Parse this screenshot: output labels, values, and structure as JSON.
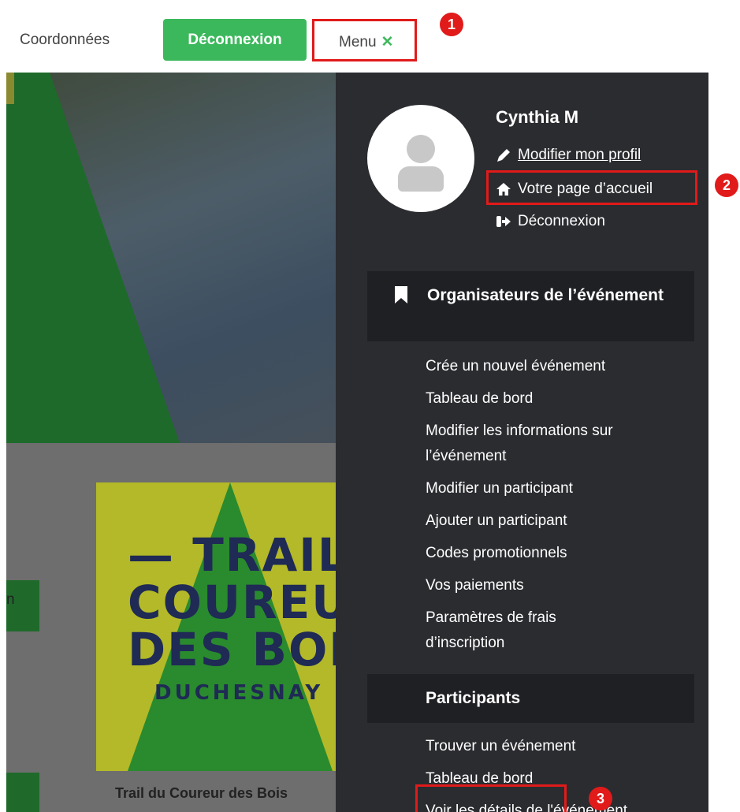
{
  "header": {
    "nav_link": "Coordonnées",
    "logout_button": "Déconnexion",
    "menu_toggle": "Menu",
    "close_glyph": "✕"
  },
  "annotations": [
    "1",
    "2",
    "3"
  ],
  "background": {
    "poster_lines": [
      "— TRAIL",
      "COUREUR",
      "DES BOIS",
      "DUCHESNAY"
    ],
    "card_title": "Trail du Coureur des Bois",
    "fragment": "n"
  },
  "side_menu": {
    "user_name": "Cynthia M",
    "profile_links": [
      {
        "label": "Modifier mon profil",
        "icon": "pencil-icon"
      },
      {
        "label": "Votre page d’accueil",
        "icon": "home-icon"
      },
      {
        "label": "Déconnexion",
        "icon": "sign-out-icon"
      }
    ],
    "organizers": {
      "title": "Organisateurs de l’événement",
      "icon": "bookmark-icon",
      "items": [
        "Crée un nouvel événement",
        "Tableau de bord",
        "Modifier les informations sur",
        "l’événement",
        "Modifier un participant",
        "Ajouter un participant",
        "Codes promotionnels",
        "Vos paiements",
        "Paramètres de frais",
        "d’inscription"
      ]
    },
    "participants": {
      "title": "Participants",
      "items": [
        "Trouver un événement",
        "Tableau de bord",
        "Voir les détails de l'événement"
      ]
    }
  },
  "colors": {
    "accent_green": "#3cb85c",
    "highlight_red": "#e11a1a",
    "panel_bg": "#2b2c30",
    "section_bg": "#1f2024"
  }
}
